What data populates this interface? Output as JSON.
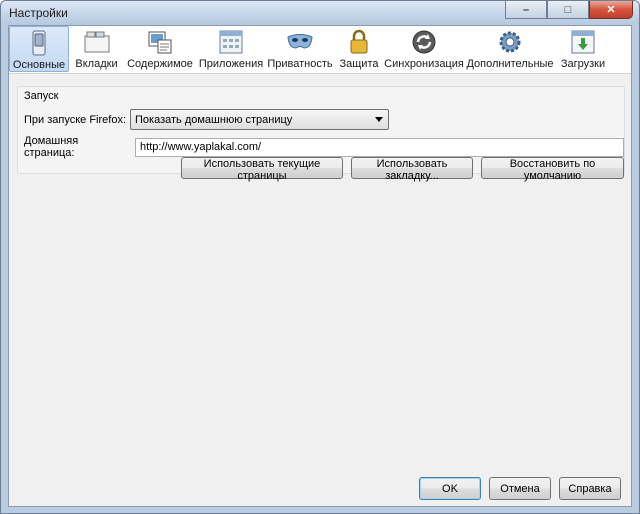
{
  "window": {
    "title": "Настройки"
  },
  "toolbar": {
    "panes": [
      {
        "label": "Основные",
        "icon": "switch-icon"
      },
      {
        "label": "Вкладки",
        "icon": "tabs-icon"
      },
      {
        "label": "Содержимое",
        "icon": "content-icon"
      },
      {
        "label": "Приложения",
        "icon": "applications-icon"
      },
      {
        "label": "Приватность",
        "icon": "privacy-mask-icon"
      },
      {
        "label": "Защита",
        "icon": "lock-icon"
      },
      {
        "label": "Синхронизация",
        "icon": "sync-icon"
      },
      {
        "label": "Дополнительные",
        "icon": "gear-icon"
      },
      {
        "label": "Загрузки",
        "icon": "downloads-icon"
      }
    ],
    "active_index": 0
  },
  "startup": {
    "group_title": "Запуск",
    "when_starts_label": "При запуске Firefox:",
    "when_starts_value": "Показать домашнюю страницу",
    "home_page_label": "Домашняя страница:",
    "home_page_value": "http://www.yaplakal.com/",
    "use_current_label": "Использовать текущие страницы",
    "use_bookmark_label": "Использовать закладку...",
    "restore_default_label": "Восстановить по умолчанию"
  },
  "footer": {
    "ok_label": "OK",
    "cancel_label": "Отмена",
    "help_label": "Справка"
  },
  "colors": {
    "active_pane": "#c3d9f3",
    "window_frame": "#b9cce0"
  }
}
